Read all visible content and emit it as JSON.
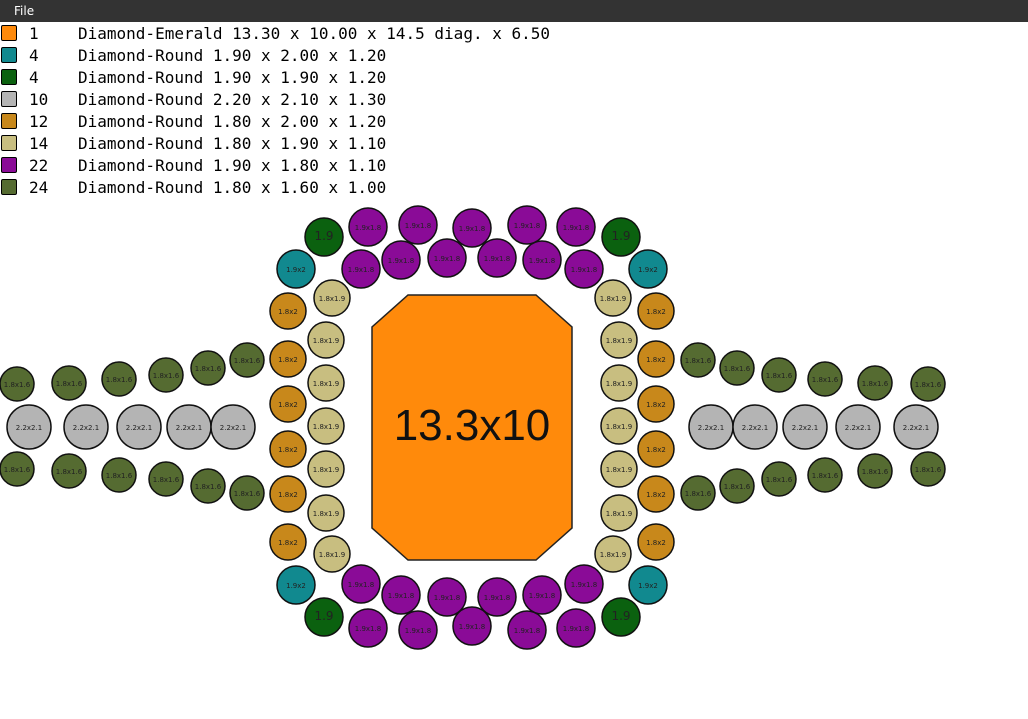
{
  "menu": {
    "file_label": "File"
  },
  "colors": {
    "orange": "#FF8A0B",
    "teal": "#11898F",
    "green": "#0B610F",
    "gray": "#B4B4B4",
    "gold": "#C8881B",
    "khaki": "#C8BE80",
    "purple": "#8A0B97",
    "olive": "#556B31"
  },
  "legend": [
    {
      "color": "orange",
      "count": "1",
      "desc": "Diamond-Emerald 13.30 x 10.00 x 14.5 diag. x 6.50"
    },
    {
      "color": "teal",
      "count": "4",
      "desc": "Diamond-Round 1.90 x 2.00 x 1.20"
    },
    {
      "color": "green",
      "count": "4",
      "desc": "Diamond-Round 1.90 x 1.90 x 1.20"
    },
    {
      "color": "gray",
      "count": "10",
      "desc": "Diamond-Round 2.20 x 2.10 x 1.30"
    },
    {
      "color": "gold",
      "count": "12",
      "desc": "Diamond-Round 1.80 x 2.00 x 1.20"
    },
    {
      "color": "khaki",
      "count": "14",
      "desc": "Diamond-Round 1.80 x 1.90 x 1.10"
    },
    {
      "color": "purple",
      "count": "22",
      "desc": "Diamond-Round 1.90 x 1.80 x 1.10"
    },
    {
      "color": "olive",
      "count": "24",
      "desc": "Diamond-Round 1.80 x 1.60 x 1.00"
    }
  ],
  "center_stone": {
    "label": "13.3x10",
    "color": "orange"
  },
  "stone_labels": {
    "teal": "1.9x2",
    "green": "1.9",
    "gray": "2.2x2.1",
    "gold": "1.8x2",
    "khaki": "1.8x1.9",
    "purple": "1.9x1.8",
    "olive": "1.8x1.6"
  }
}
